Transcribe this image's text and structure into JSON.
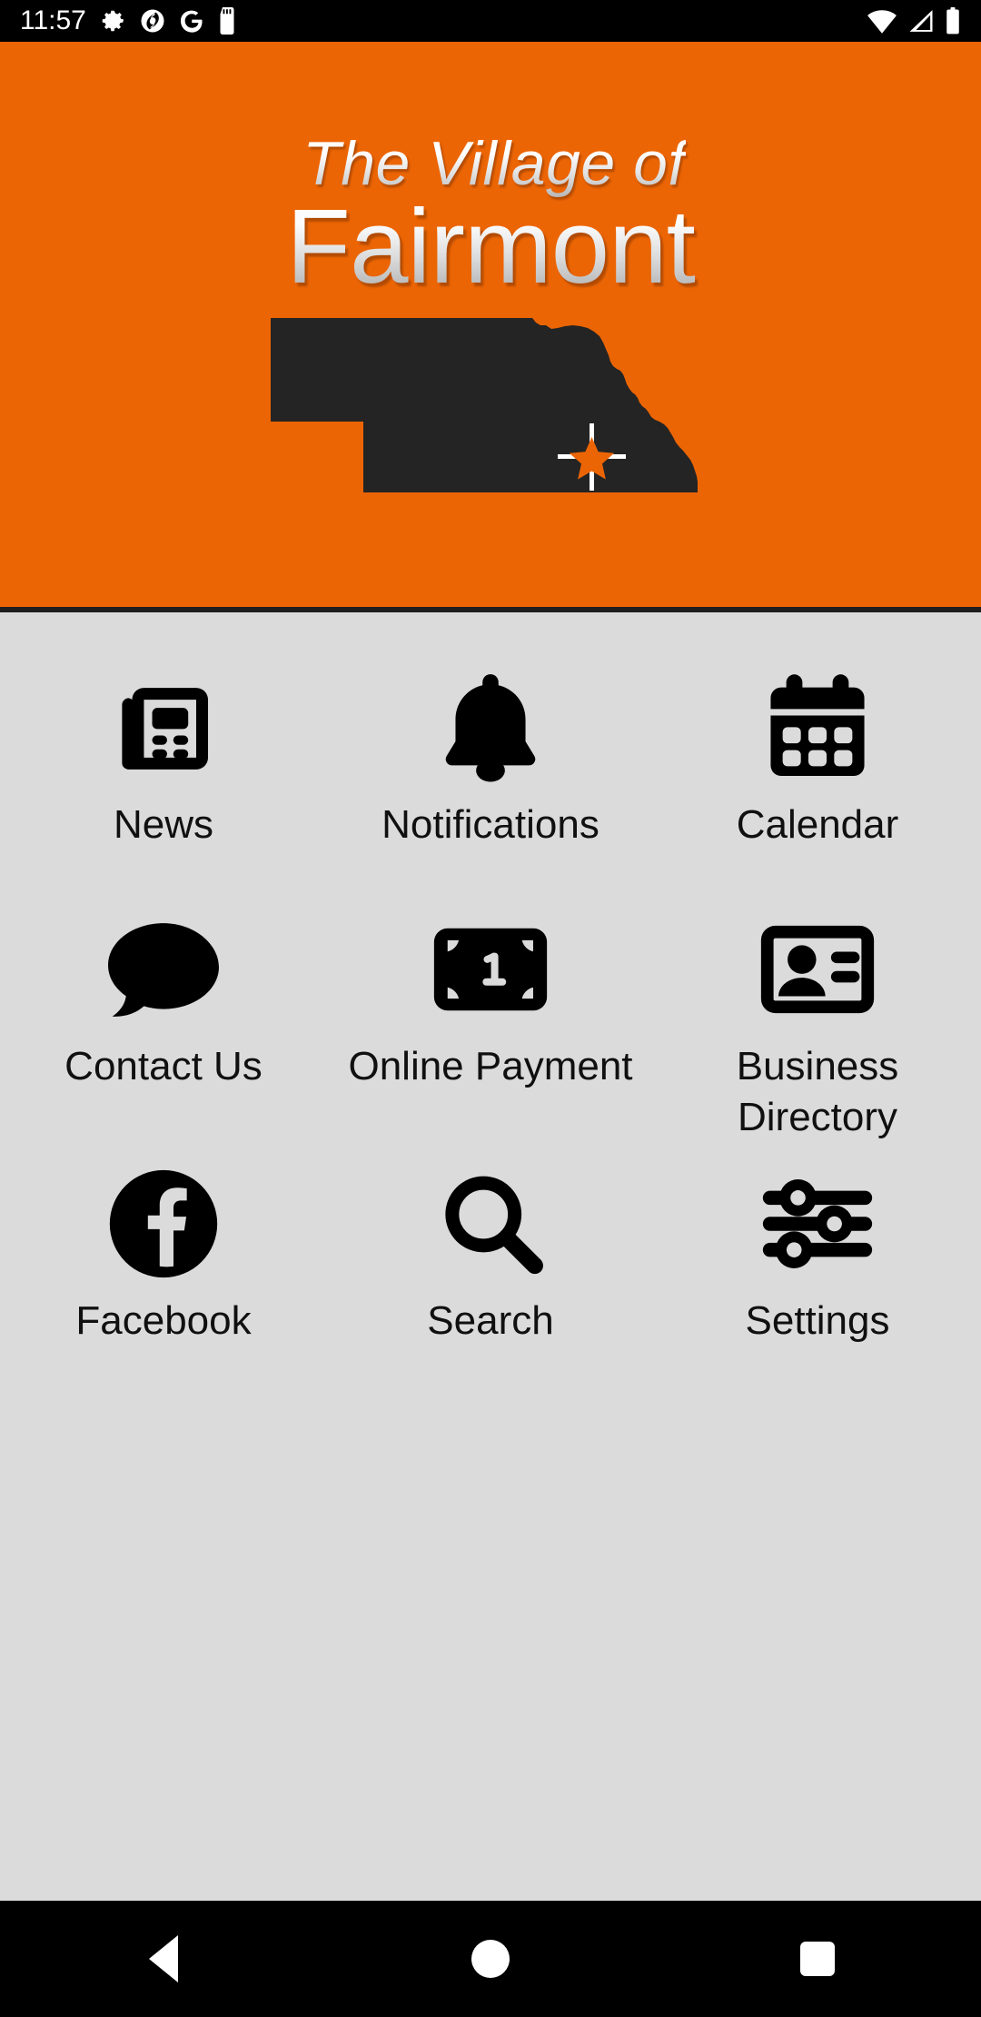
{
  "status_bar": {
    "clock": "11:57",
    "left_icons": [
      "gear-icon",
      "spiral-icon",
      "google-g-icon",
      "sd-card-icon"
    ],
    "right_icons": [
      "wifi-icon",
      "cellular-signal-icon",
      "battery-icon"
    ]
  },
  "header": {
    "title_line1": "The Village of",
    "title_line2": "Fairmont",
    "background_color": "#ec6504",
    "map_color": "#242424",
    "marker_color": "#ec6504",
    "marker_crosshair_color": "#ffffff",
    "map_name": "nebraska-state-outline"
  },
  "grid": {
    "rows": [
      [
        {
          "label": "News",
          "icon": "newspaper-icon"
        },
        {
          "label": "Notifications",
          "icon": "bell-icon"
        },
        {
          "label": "Calendar",
          "icon": "calendar-icon"
        }
      ],
      [
        {
          "label": "Contact Us",
          "icon": "speech-bubble-icon"
        },
        {
          "label": "Online Payment",
          "icon": "banknote-icon"
        },
        {
          "label": "Business Directory",
          "icon": "contact-card-icon"
        }
      ],
      [
        {
          "label": "Facebook",
          "icon": "facebook-icon"
        },
        {
          "label": "Search",
          "icon": "magnifier-icon"
        },
        {
          "label": "Settings",
          "icon": "sliders-icon"
        }
      ]
    ]
  },
  "nav_bar": {
    "back_label": "Back",
    "home_label": "Home",
    "recents_label": "Recents"
  },
  "colors": {
    "accent": "#ec6504",
    "body_background": "#dbdbdb",
    "icon": "#000000",
    "text": "#101010"
  }
}
